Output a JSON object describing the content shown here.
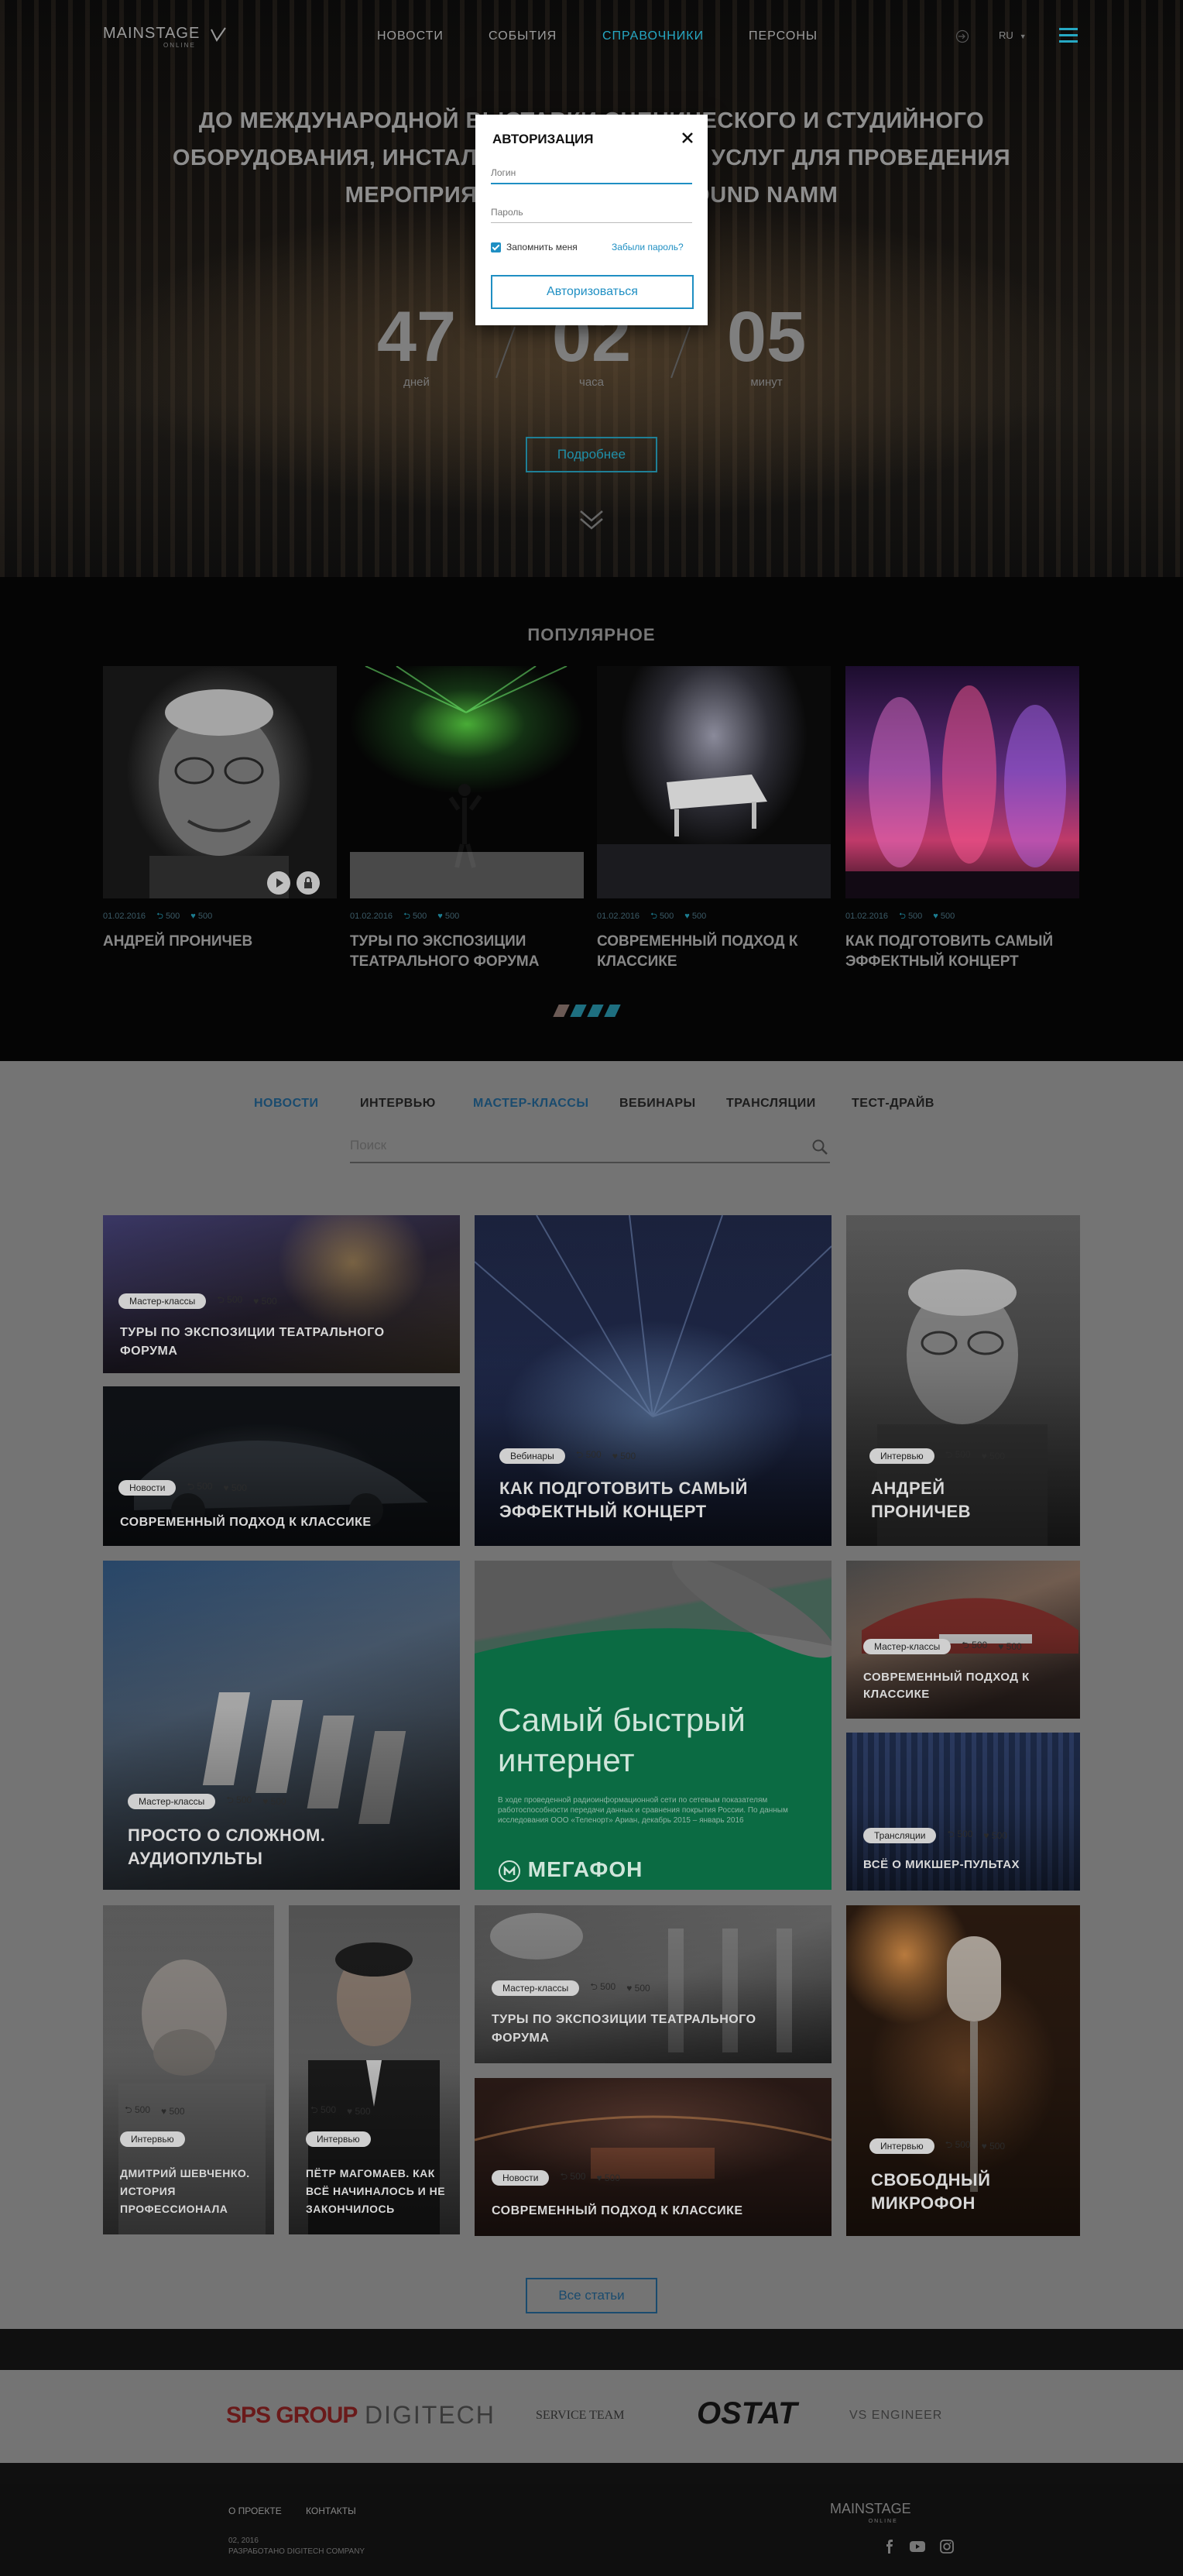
{
  "header": {
    "logo_text": "MAINSTAGE",
    "logo_sub": "ONLINE",
    "nav": [
      "НОВОСТИ",
      "СОБЫТИЯ",
      "СПРАВОЧНИКИ",
      "ПЕРСОНЫ"
    ],
    "active_nav": "СПРАВОЧНИКИ",
    "lang": "RU"
  },
  "hero": {
    "title_line1": "ДО МЕЖДУНАРОДНОЙ ВЫСТАВКИ СЦЕНИЧЕСКОГО И СТУДИЙНОГО",
    "title_line2": "ОБОРУДОВАНИЯ, ИНСТАЛЛЯЦИИ, ТЕХНИКИ И УСЛУГ ДЛЯ ПРОВЕДЕНИЯ",
    "title_line3": "МЕРОПРИЯТИЙ PROLIGHT + SOUND NAMM",
    "countdown": [
      {
        "value": "47",
        "label": "дней"
      },
      {
        "value": "02",
        "label": "часа"
      },
      {
        "value": "05",
        "label": "минут"
      }
    ],
    "more_button": "Подробнее"
  },
  "popular": {
    "title": "ПОПУЛЯРНОЕ",
    "cards": [
      {
        "date": "01.02.2016",
        "reposts": "500",
        "likes": "500",
        "title": "АНДРЕЙ ПРОНИЧЕВ"
      },
      {
        "date": "01.02.2016",
        "reposts": "500",
        "likes": "500",
        "title": "ТУРЫ ПО ЭКСПОЗИЦИИ ТЕАТРАЛЬНОГО ФОРУМА"
      },
      {
        "date": "01.02.2016",
        "reposts": "500",
        "likes": "500",
        "title": "СОВРЕМЕННЫЙ ПОДХОД К КЛАССИКЕ"
      },
      {
        "date": "01.02.2016",
        "reposts": "500",
        "likes": "500",
        "title": "КАК ПОДГОТОВИТЬ САМЫЙ ЭФФЕКТНЫЙ КОНЦЕРТ"
      }
    ]
  },
  "filters": {
    "tabs": [
      "НОВОСТИ",
      "ИНТЕРВЬЮ",
      "МАСТЕР-КЛАССЫ",
      "ВЕБИНАРЫ",
      "ТРАНСЛЯЦИИ",
      "ТЕСТ-ДРАЙВ"
    ],
    "active_tabs": [
      "НОВОСТИ",
      "МАСТЕР-КЛАССЫ"
    ],
    "search_placeholder": "Поиск"
  },
  "tiles": [
    {
      "tag": "Мастер-классы",
      "reposts": "500",
      "likes": "500",
      "title": "ТУРЫ ПО ЭКСПОЗИЦИИ ТЕАТРАЛЬНОГО ФОРУМА"
    },
    {
      "tag": "Новости",
      "reposts": "500",
      "likes": "500",
      "title": "СОВРЕМЕННЫЙ ПОДХОД К КЛАССИКЕ"
    },
    {
      "tag": "Вебинары",
      "reposts": "500",
      "likes": "500",
      "title": "КАК ПОДГОТОВИТЬ САМЫЙ ЭФФЕКТНЫЙ КОНЦЕРТ"
    },
    {
      "tag": "Интервью",
      "reposts": "500",
      "likes": "500",
      "title": "АНДРЕЙ ПРОНИЧЕВ"
    },
    {
      "tag": "Мастер-классы",
      "reposts": "500",
      "likes": "500",
      "title": "ПРОСТО О СЛОЖНОМ. АУДИОПУЛЬТЫ"
    },
    {
      "tag": "Мастер-классы",
      "reposts": "500",
      "likes": "500",
      "title": "СОВРЕМЕННЫЙ ПОДХОД К КЛАССИКЕ"
    },
    {
      "tag": "Трансляции",
      "reposts": "500",
      "likes": "500",
      "title": "ВСЁ О МИКШЕР-ПУЛЬТАХ"
    },
    {
      "tag": "Интервью",
      "reposts": "500",
      "likes": "500",
      "title": "ДМИТРИЙ ШЕВЧЕНКО. ИСТОРИЯ ПРОФЕССИОНАЛА"
    },
    {
      "tag": "Интервью",
      "reposts": "500",
      "likes": "500",
      "title": "ПЁТР МАГОМАЕВ. КАК ВСЁ НАЧИНАЛОСЬ И НЕ ЗАКОНЧИЛОСЬ"
    },
    {
      "tag": "Мастер-классы",
      "reposts": "500",
      "likes": "500",
      "title": "ТУРЫ ПО ЭКСПОЗИЦИИ ТЕАТРАЛЬНОГО ФОРУМА"
    },
    {
      "tag": "Новости",
      "reposts": "500",
      "likes": "500",
      "title": "СОВРЕМЕННЫЙ ПОДХОД К КЛАССИКЕ"
    },
    {
      "tag": "Интервью",
      "reposts": "500",
      "likes": "500",
      "title": "СВОБОДНЫЙ МИКРОФОН"
    }
  ],
  "ad": {
    "headline_line1": "Самый быстрый",
    "headline_line2": "интернет",
    "fine_print": "В ходе проведенной радиоинформационной сети по сетевым показателям работоспособности передачи данных и сравнения покрытия России. По данным исследования ООО «Теленорт» Ариан, декабрь 2015 – январь 2016",
    "brand": "МЕГАФОН"
  },
  "all_articles_button": "Все статьи",
  "partners": [
    "SPS GROUP",
    "DIGITECH",
    "SERVICE TEAM",
    "OSTAT",
    "VS ENGINEER"
  ],
  "footer": {
    "links": [
      "О ПРОЕКТЕ",
      "КОНТАКТЫ"
    ],
    "copyright": "02, 2016",
    "developer": "РАЗРАБОТАНО DIGITECH COMPANY",
    "logo_text": "MAINSTAGE",
    "logo_sub": "ONLINE"
  },
  "modal": {
    "title": "АВТОРИЗАЦИЯ",
    "login_placeholder": "Логин",
    "password_placeholder": "Пароль",
    "remember": "Запомнить меня",
    "forgot": "Забыли пароль?",
    "submit": "Авторизоваться"
  },
  "colors": {
    "accent": "#1f8fc3",
    "teal": "#26a8c3"
  }
}
